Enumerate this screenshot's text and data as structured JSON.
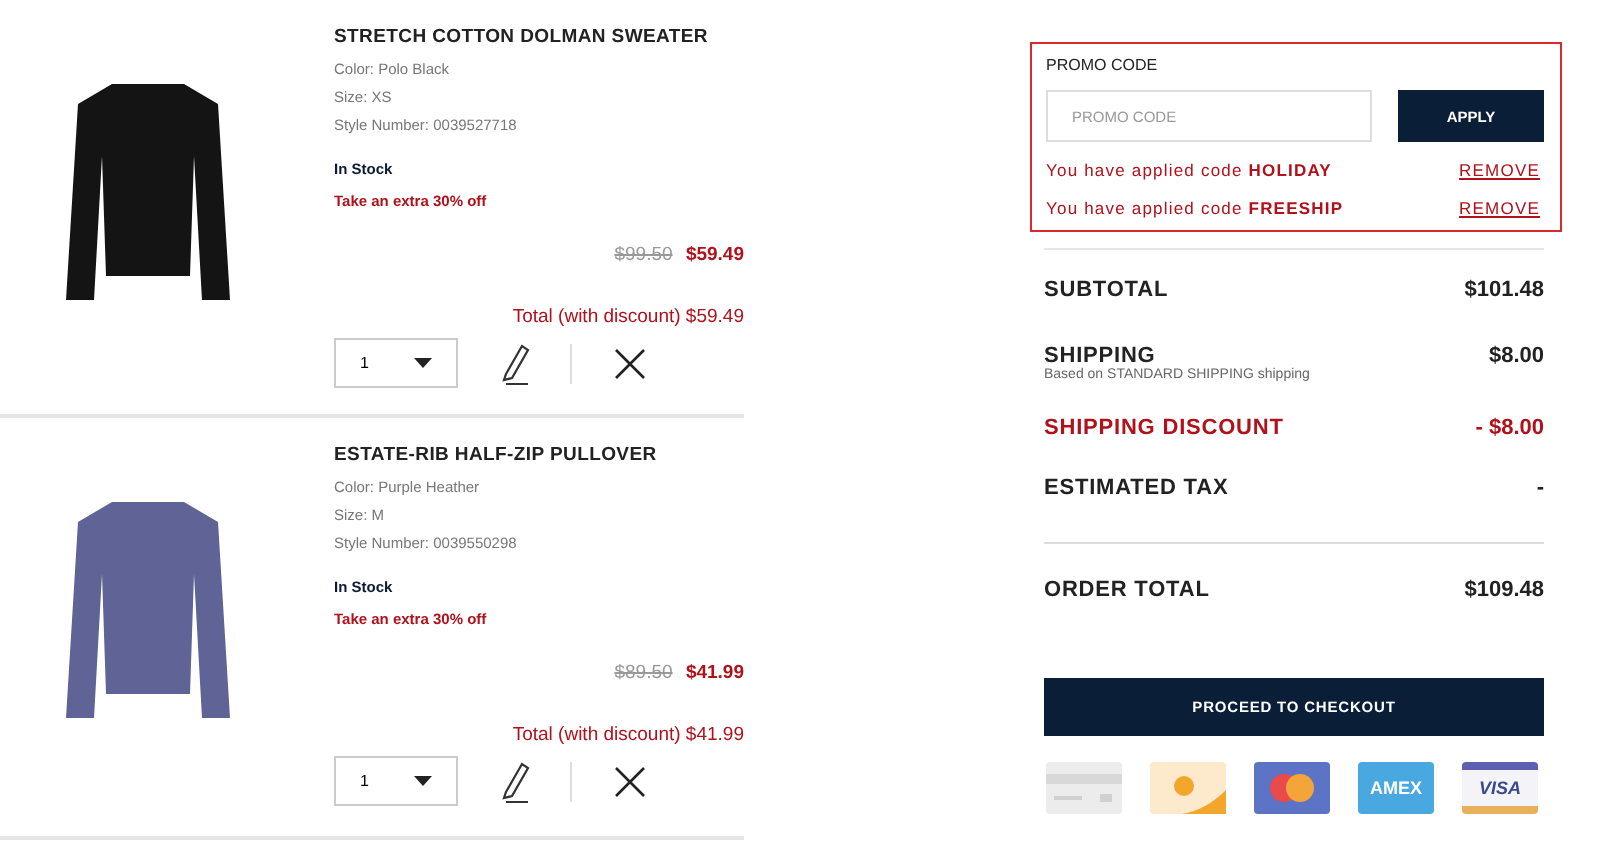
{
  "items": [
    {
      "name": "STRETCH COTTON DOLMAN SWEATER",
      "details": [
        "Color: Polo Black",
        "Size: XS",
        "Style Number: 0039527718"
      ],
      "stock": "In Stock",
      "offer": "Take an extra 30% off",
      "original_price": "$99.50",
      "price": "$59.49",
      "total": "Total (with discount) $59.49",
      "quantity": "1",
      "color": "#141414"
    },
    {
      "name": "ESTATE-RIB HALF-ZIP PULLOVER",
      "details": [
        "Color: Purple Heather",
        "Size: M",
        "Style Number: 0039550298"
      ],
      "stock": "In Stock",
      "offer": "Take an extra 30% off",
      "original_price": "$89.50",
      "price": "$41.99",
      "total": "Total (with discount) $41.99",
      "quantity": "1",
      "color": "#5f6396"
    }
  ],
  "promo": {
    "label": "PROMO CODE",
    "placeholder": "PROMO CODE",
    "apply_button": "APPLY",
    "applied": [
      {
        "text": "You have applied code **HOLIDAY**",
        "remove": "REMOVE"
      },
      {
        "text": "You have applied code **FREESHIP**",
        "remove": "REMOVE"
      }
    ]
  },
  "summary": [
    {
      "label": "SUBTOTAL",
      "value": "$101.48",
      "kind": "normal"
    },
    {
      "label": "SHIPPING",
      "note": "Based on STANDARD SHIPPING shipping",
      "value": "$8.00",
      "kind": "normal"
    },
    {
      "label": "SHIPPING DISCOUNT",
      "value": "- $8.00",
      "kind": "discount"
    },
    {
      "label": "ESTIMATED TAX",
      "value": "-",
      "kind": "normal"
    }
  ],
  "order_total": {
    "label": "ORDER TOTAL",
    "value": "$109.48"
  },
  "checkout_button": "PROCEED TO CHECKOUT",
  "payment_methods": [
    {
      "kind": "card"
    },
    {
      "kind": "orange"
    },
    {
      "kind": "mastercard"
    },
    {
      "kind": "text",
      "label": "AMEX",
      "color": "#4aa8e0"
    },
    {
      "kind": "visa",
      "label": "VISA"
    }
  ]
}
